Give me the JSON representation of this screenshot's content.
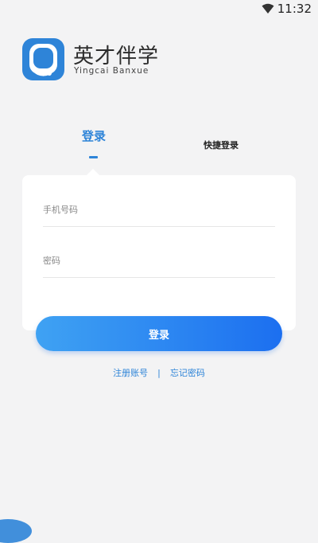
{
  "status": {
    "time": "11:32",
    "wifi_icon": "wifi-icon"
  },
  "brand": {
    "name": "英才伴学",
    "name_en": "Yingcai Banxue",
    "logo_icon": "headset-avatar-logo-icon",
    "accent": "#2e84d8"
  },
  "tabs": [
    {
      "label": "登录",
      "active": true
    },
    {
      "label": "快捷登录",
      "active": false
    }
  ],
  "form": {
    "phone_placeholder": "手机号码",
    "phone_value": "",
    "password_placeholder": "密码",
    "password_value": ""
  },
  "login_button": {
    "label": "登录"
  },
  "links": {
    "register": "注册账号",
    "separator": "|",
    "forgot": "忘记密码"
  }
}
